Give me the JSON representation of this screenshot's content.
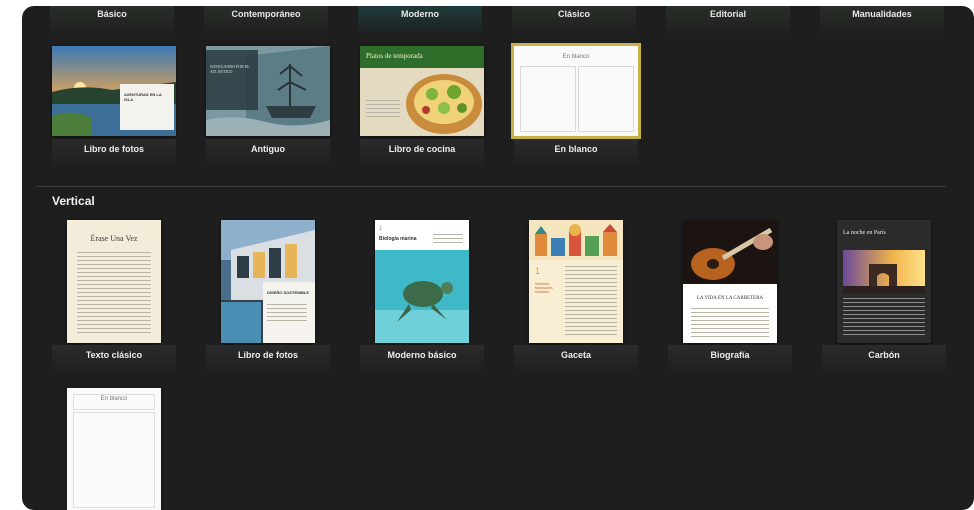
{
  "top_row": [
    "Básico",
    "Contemporáneo",
    "Moderno",
    "Clásico",
    "Editorial",
    "Manualidades"
  ],
  "landscape": [
    {
      "label": "Libro de fotos",
      "title": "AVENTURAS EN LA ISLA"
    },
    {
      "label": "Antiguo",
      "title": "NAVEGANDO POR EL ATLÁNTICO"
    },
    {
      "label": "Libro de cocina",
      "title": "Platos de temporada"
    },
    {
      "label": "En blanco",
      "title": "En blanco"
    }
  ],
  "section": {
    "vertical": "Vertical"
  },
  "vertical": [
    {
      "label": "Texto clásico",
      "title": "Érase Una Vez"
    },
    {
      "label": "Libro de fotos",
      "title": "DISEÑO SOSTENIBLE"
    },
    {
      "label": "Moderno básico",
      "title": "Biología marina",
      "number": "1"
    },
    {
      "label": "Gaceta",
      "title": "Nuestras fascinantes ciudades",
      "number": "1"
    },
    {
      "label": "Biografía",
      "title": "LA VIDA EN LA CARRETERA"
    },
    {
      "label": "Carbón",
      "title": "La noche en París"
    },
    {
      "label": "",
      "title": "En blanco"
    }
  ],
  "colors": {
    "selection": "#c9b14a",
    "background": "#1e1e1e"
  }
}
